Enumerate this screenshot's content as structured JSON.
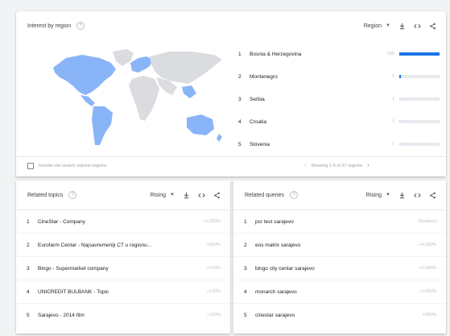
{
  "region_panel": {
    "title": "Interest by region",
    "help_icon": "help-circle-icon",
    "view_select": "Region",
    "tools": [
      "download-icon",
      "embed-icon",
      "share-icon"
    ],
    "regions": [
      {
        "rank": "1",
        "name": "Bosnia & Herzegovina",
        "value": "100",
        "level": 1.0
      },
      {
        "rank": "2",
        "name": "Montenegro",
        "value": "3",
        "level": 0.03
      },
      {
        "rank": "3",
        "name": "Serbia",
        "value": "1",
        "level": 0.01
      },
      {
        "rank": "4",
        "name": "Croatia",
        "value": "1",
        "level": 0.01
      },
      {
        "rank": "5",
        "name": "Slovenia",
        "value": "1",
        "level": 0.01
      }
    ],
    "low_volume_label": "Include low search volume regions",
    "pager_text": "Showing 1-5 of 37 regions",
    "colors": {
      "highlight": "#8ab4f8",
      "land": "#dadce0",
      "bar": "#1a73e8"
    }
  },
  "topics_panel": {
    "title": "Related topics",
    "filter": "Rising",
    "items": [
      {
        "rank": "1",
        "label": "CineStar - Company",
        "change": "+1,300%"
      },
      {
        "rank": "2",
        "label": "Eurofarm Centar - Najsavremeniji CT u regionu...",
        "change": "+550%"
      },
      {
        "rank": "3",
        "label": "Bingo - Supermarket company",
        "change": "+170%"
      },
      {
        "rank": "4",
        "label": "UNICREDIT BULBANK - Topic",
        "change": "+130%"
      },
      {
        "rank": "5",
        "label": "Sarajevo - 2014 film",
        "change": "+110%"
      }
    ]
  },
  "queries_panel": {
    "title": "Related queries",
    "filter": "Rising",
    "items": [
      {
        "rank": "1",
        "label": "pcr test sarajevo",
        "change": "Breakout"
      },
      {
        "rank": "2",
        "label": "eos matrix sarajevo",
        "change": "+4,200%"
      },
      {
        "rank": "3",
        "label": "bingo city centar sarajevo",
        "change": "+2,500%"
      },
      {
        "rank": "4",
        "label": "monarch sarajevo",
        "change": "+1,550%"
      },
      {
        "rank": "5",
        "label": "cinestar sarajevo",
        "change": "+950%"
      }
    ]
  }
}
